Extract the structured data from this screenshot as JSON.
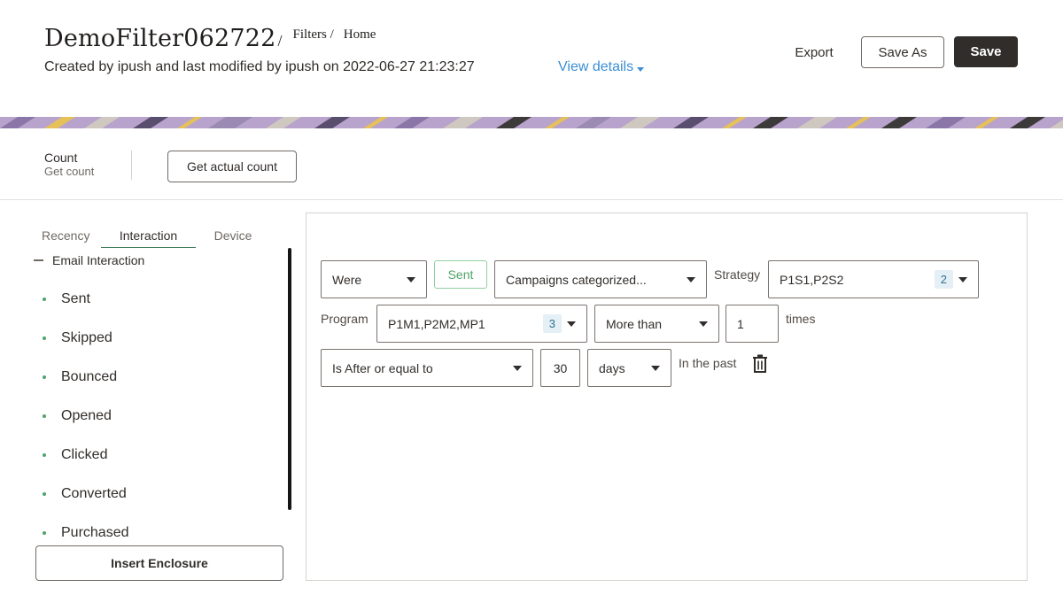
{
  "header": {
    "title": "DemoFilter062722",
    "breadcrumb": [
      "Filters /",
      "Home"
    ],
    "subtitle": "Created by ipush and last modified by ipush on 2022-06-27 21:23:27",
    "view_details": "View details",
    "export_label": "Export",
    "save_as_label": "Save As",
    "save_label": "Save"
  },
  "count": {
    "label": "Count",
    "sublabel": "Get count",
    "button": "Get actual count"
  },
  "tabs": [
    "Recency",
    "Interaction",
    "Device"
  ],
  "active_tab": "Interaction",
  "tree": {
    "header": "Email Interaction",
    "items": [
      "Sent",
      "Skipped",
      "Bounced",
      "Opened",
      "Clicked",
      "Converted",
      "Purchased"
    ]
  },
  "insert_button": "Insert Enclosure",
  "criteria": {
    "were": "Were",
    "sent_tag": "Sent",
    "campaigns": "Campaigns categorized...",
    "strategy_label": "Strategy",
    "strategy_value": "P1S1,P2S2",
    "strategy_count": "2",
    "program_label": "Program",
    "program_value": "P1M1,P2M2,MP1",
    "program_count": "3",
    "comparator": "More than",
    "times_value": "1",
    "times_label": "times",
    "date_operator": "Is After or equal to",
    "days_value": "30",
    "days_unit": "days",
    "in_the_past": "In the past"
  },
  "colors": {
    "primary_dark": "#312d2a",
    "link_blue": "#3b8ed4",
    "accent_green": "#4fa36a",
    "band_purple": "#b7a3cc"
  }
}
